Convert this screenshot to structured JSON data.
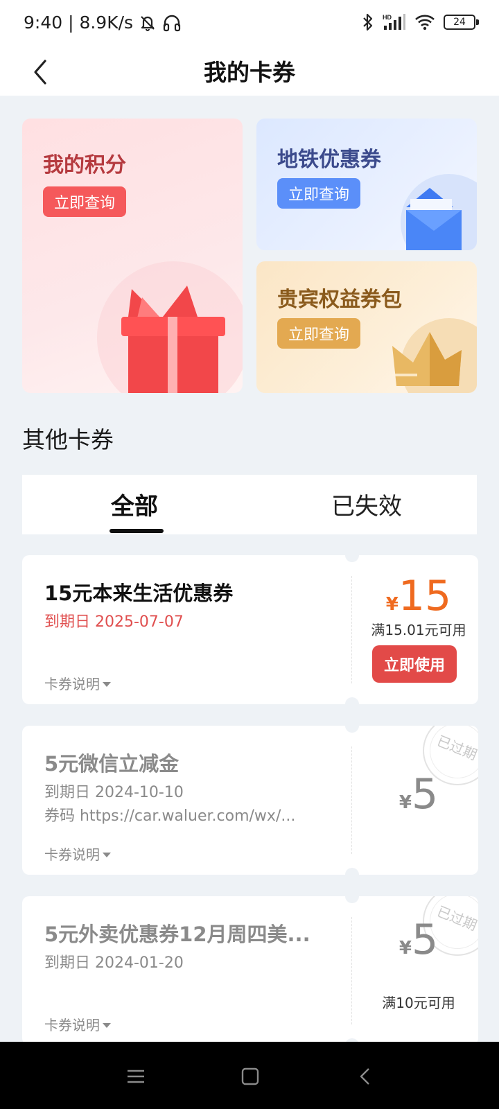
{
  "status": {
    "time_speed": "9:40 | 8.9K/s",
    "battery": "24",
    "hd": "HD"
  },
  "nav": {
    "title": "我的卡券"
  },
  "cards": {
    "points": {
      "title": "我的积分",
      "button": "立即查询"
    },
    "metro": {
      "title": "地铁优惠券",
      "button": "立即查询"
    },
    "vip": {
      "title": "贵宾权益券包",
      "button": "立即查询"
    }
  },
  "section_title": "其他卡券",
  "tabs": {
    "all": "全部",
    "expired": "已失效"
  },
  "coupons": [
    {
      "title": "15元本来生活优惠券",
      "date": "到期日 2025-07-07",
      "desc": "卡券说明",
      "currency": "¥",
      "amount": "15",
      "condition": "满15.01元可用",
      "button": "立即使用"
    },
    {
      "title": "5元微信立减金",
      "date": "到期日 2024-10-10",
      "code": "券码  https://car.waluer.com/wx/...",
      "desc": "卡券说明",
      "currency": "¥",
      "amount": "5",
      "stamp": "已过期"
    },
    {
      "title": "5元外卖优惠券12月周四美...",
      "date": "到期日 2024-01-20",
      "desc": "卡券说明",
      "currency": "¥",
      "amount": "5",
      "condition": "满10元可用",
      "stamp": "已过期"
    }
  ],
  "icons": {
    "back": "chevron-left-icon",
    "menu": "menu-icon",
    "home": "home-square-icon",
    "nav_back": "back-triangle-icon"
  },
  "colors": {
    "accent_red": "#e24a48",
    "amount_orange": "#ef6a1f",
    "date_red": "#e04f4f",
    "metro_button": "#5b8ff9",
    "vip_button": "#e3a951",
    "points_button": "#f5595b"
  }
}
